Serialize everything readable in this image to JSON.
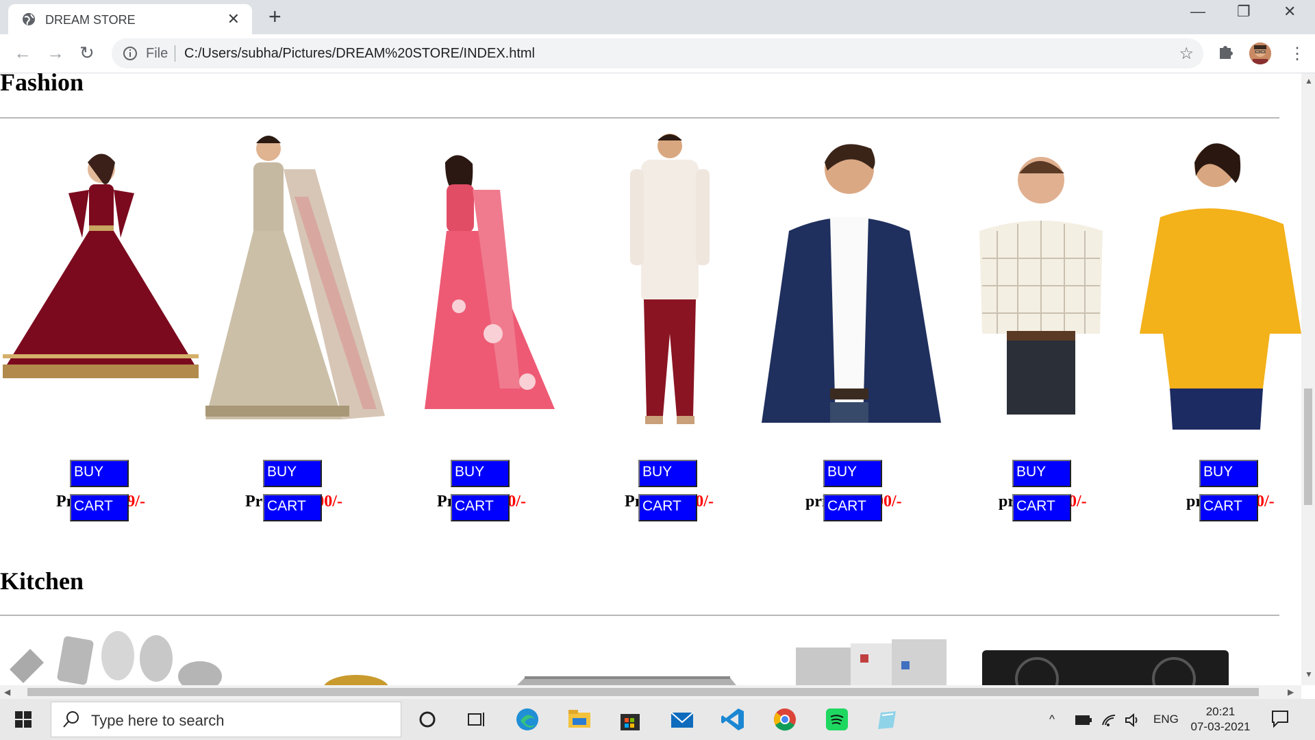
{
  "browser": {
    "tab_title": "DREAM STORE",
    "tab_close": "✕",
    "new_tab": "+",
    "window_controls": {
      "minimize": "—",
      "restore": "❐",
      "close": "✕"
    },
    "nav": {
      "back": "←",
      "forward": "→",
      "reload": "↻"
    },
    "address": {
      "scheme_label": "File",
      "url": "C:/Users/subha/Pictures/DREAM%20STORE/INDEX.html"
    },
    "bookmark_star": "☆",
    "menu": "⋮"
  },
  "page": {
    "sections": [
      {
        "title": "Fashion"
      },
      {
        "title": "Kitchen"
      }
    ],
    "products": [
      {
        "price_label": "Price:",
        "price": "9,999/-",
        "buy": "BUY",
        "cart": "CART",
        "image": "maroon-anarkali-gown"
      },
      {
        "price_label": "Price:",
        "price": "15,000/-",
        "buy": "BUY",
        "cart": "CART",
        "image": "beige-lehenga-dupatta"
      },
      {
        "price_label": "Price:",
        "price": "8,000/-",
        "buy": "BUY",
        "cart": "CART",
        "image": "pink-saree"
      },
      {
        "price_label": "Price:",
        "price": "3,000/-",
        "buy": "BUY",
        "cart": "CART",
        "image": "white-kurta-maroon-dhoti"
      },
      {
        "price_label": "price:",
        "price": "12,000/-",
        "buy": "BUY",
        "cart": "CART",
        "image": "navy-blazer-white-shirt"
      },
      {
        "price_label": "price:",
        "price": "2,400/-",
        "buy": "BUY",
        "cart": "CART",
        "image": "checked-shirt-men"
      },
      {
        "price_label": "price:",
        "price": "2,500/-",
        "buy": "BUY",
        "cart": "CART",
        "image": "yellow-top-women"
      }
    ],
    "kitchen_images": [
      "kitchen-utensils-set",
      "pan",
      "induction-cooktop",
      "refrigerator",
      "gas-stove"
    ]
  },
  "taskbar": {
    "search_placeholder": "Type here to search",
    "language": "ENG",
    "time": "20:21",
    "date": "07-03-2021",
    "apps": [
      "cortana-icon",
      "task-view-icon",
      "edge-icon",
      "file-explorer-icon",
      "store-icon",
      "mail-icon",
      "vscode-icon",
      "chrome-icon",
      "spotify-icon",
      "notepad-icon"
    ]
  },
  "colors": {
    "price": "#ff0000",
    "button_bg": "#0000ff",
    "button_text": "#ffffff"
  }
}
